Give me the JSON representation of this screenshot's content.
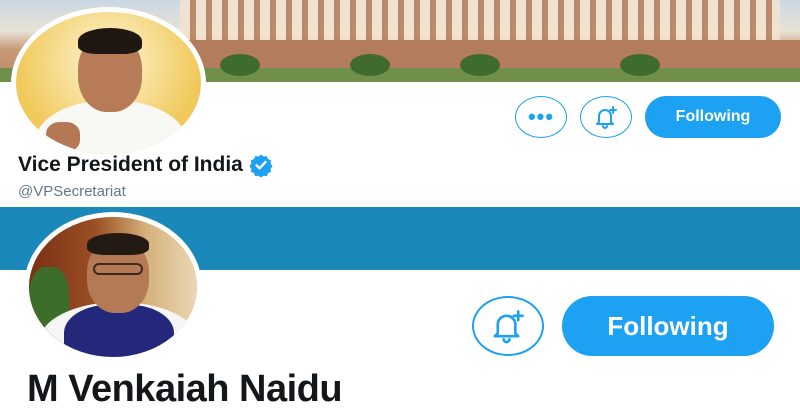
{
  "profiles": [
    {
      "name": "Vice President of India",
      "handle": "@VPSecretariat",
      "verified": true,
      "more_icon": "ellipsis-icon",
      "bell_icon": "bell-plus-icon",
      "follow_label": "Following"
    },
    {
      "name": "M Venkaiah Naidu",
      "bell_icon": "bell-plus-icon",
      "follow_label": "Following"
    }
  ],
  "colors": {
    "accent": "#1da1f2",
    "divider": "#1a88b8",
    "text": "#14171a",
    "muted": "#657786"
  }
}
